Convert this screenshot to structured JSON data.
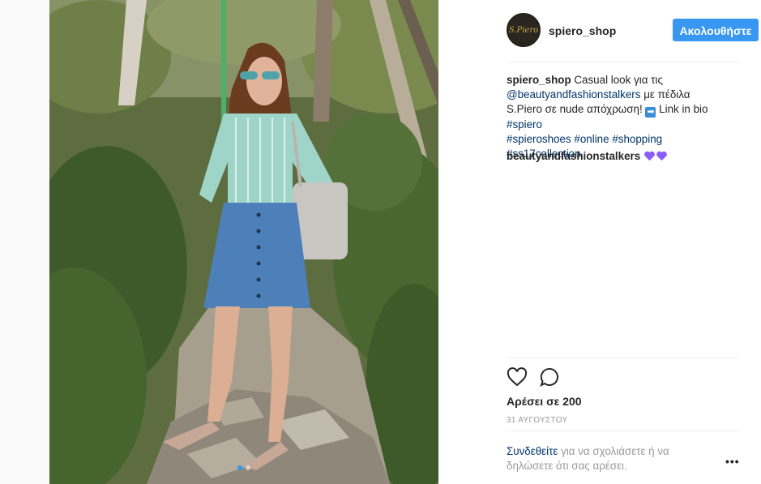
{
  "post": {
    "username": "spiero_shop",
    "avatar_text": "S.Piero",
    "follow_label": "Ακολουθήστε",
    "caption": {
      "user": "spiero_shop",
      "text_1": "Casual look για τις",
      "mention": "@beautyandfashionstalkers",
      "text_2": "με πέδιλα S.Piero σε nude απόχρωση!",
      "arrow": "➡",
      "text_3": "Link in bio",
      "hashtags": [
        "#spiero",
        "#spieroshoes",
        "#online",
        "#shopping",
        "#ss17collection"
      ]
    },
    "comment": {
      "user": "beautyandfashionstalkers",
      "emoji": "💜💜"
    },
    "likes": "Αρέσει σε 200",
    "date": "31 ΑΥΓΟΥΣΤΟΥ",
    "login_link": "Συνδεθείτε",
    "login_text": "για να σχολιάσετε ή να δηλώσετε ότι σας αρέσει.",
    "more": "•••",
    "icons": {
      "like": "heart-icon",
      "comment": "comment-icon",
      "more": "more-options-icon"
    },
    "colors": {
      "accent": "#3897f0",
      "link": "#003569",
      "muted": "#999999",
      "heart_emoji": "#8b5cf6"
    },
    "carousel": {
      "total": 2,
      "active": 1
    }
  }
}
